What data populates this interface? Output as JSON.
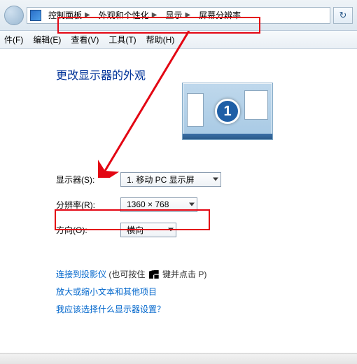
{
  "breadcrumb": {
    "items": [
      "控制面板",
      "外观和个性化",
      "显示",
      "屏幕分辨率"
    ]
  },
  "menus": [
    "件(F)",
    "编辑(E)",
    "查看(V)",
    "工具(T)",
    "帮助(H)"
  ],
  "page_title": "更改显示器的外观",
  "monitor_number": "1",
  "form": {
    "display_label": "显示器(S):",
    "display_value": "1. 移动 PC 显示屏",
    "resolution_label": "分辨率(R):",
    "resolution_value": "1360 × 768",
    "orientation_label": "方向(O):",
    "orientation_value": "横向"
  },
  "links": {
    "projector": "连接到投影仪",
    "projector_note_prefix": " (也可按住 ",
    "projector_note_suffix": " 键并点击 P)",
    "text_size": "放大或缩小文本和其他项目",
    "which_display": "我应该选择什么显示器设置？"
  }
}
